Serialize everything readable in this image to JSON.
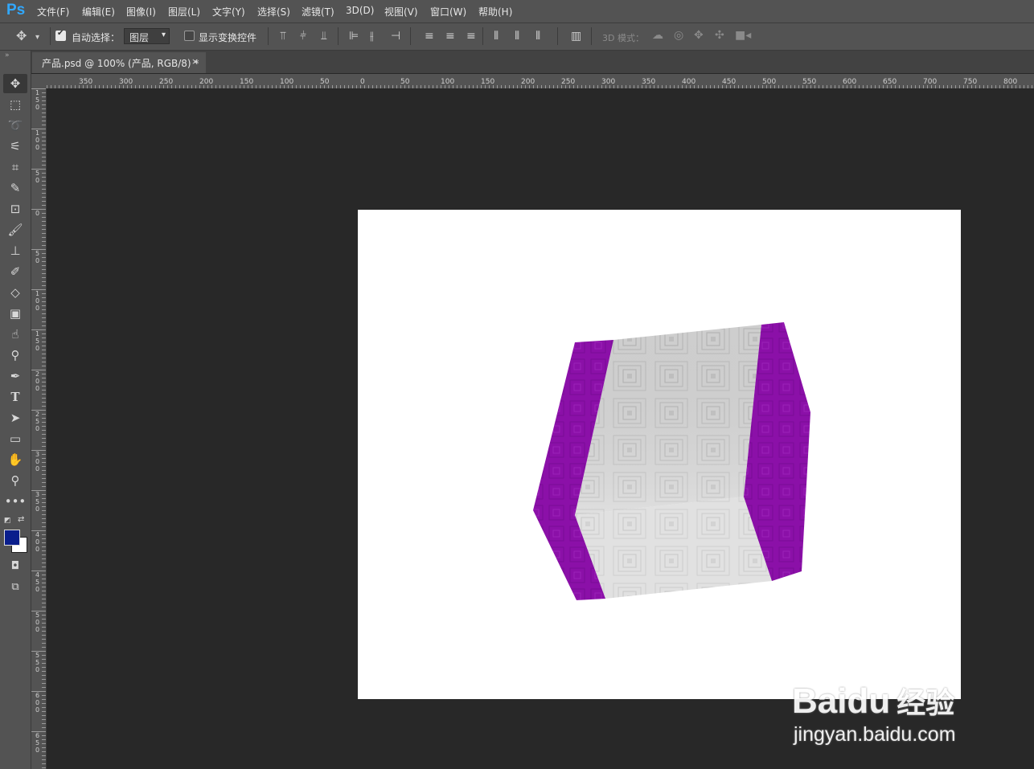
{
  "app": {
    "logo": "Ps"
  },
  "menu": [
    "文件(F)",
    "编辑(E)",
    "图像(I)",
    "图层(L)",
    "文字(Y)",
    "选择(S)",
    "滤镜(T)",
    "3D(D)",
    "视图(V)",
    "窗口(W)",
    "帮助(H)"
  ],
  "options": {
    "auto_select_label": "自动选择：",
    "auto_select_checked": true,
    "layer_select_value": "图层",
    "show_transform_label": "显示变换控件",
    "show_transform_checked": false,
    "mode_3d_label": "3D 模式："
  },
  "document": {
    "tab_title": "产品.psd @ 100% (产品, RGB/8) *",
    "close_glyph": "×"
  },
  "ruler": {
    "top_labels": [
      "350",
      "300",
      "250",
      "200",
      "150",
      "100",
      "50",
      "0",
      "50",
      "100",
      "150",
      "200",
      "250",
      "300",
      "350",
      "400",
      "450",
      "500",
      "550",
      "600",
      "650",
      "700",
      "750",
      "800"
    ],
    "left_labels": [
      "150",
      "100",
      "50",
      "0",
      "50",
      "100",
      "150",
      "200",
      "250",
      "300",
      "350",
      "400",
      "450",
      "500",
      "550",
      "600",
      "650"
    ]
  },
  "colors": {
    "foreground": "#0a1e8c",
    "background": "#ffffff",
    "purple": "#8b10a8",
    "accent": "#31a8ff"
  },
  "watermark": {
    "brand": "Bai",
    "brand2": "du",
    "cn": "经验",
    "url": "jingyan.baidu.com"
  },
  "tools": [
    "move-tool",
    "marquee-tool",
    "lasso-tool",
    "magic-wand-tool",
    "crop-tool",
    "eyedropper-tool",
    "patch-tool",
    "brush-tool",
    "stamp-tool",
    "history-brush-tool",
    "eraser-tool",
    "gradient-tool",
    "smudge-tool",
    "dodge-tool",
    "pen-tool",
    "type-tool",
    "path-select-tool",
    "rectangle-tool",
    "hand-tool",
    "zoom-tool",
    "more-tools"
  ]
}
